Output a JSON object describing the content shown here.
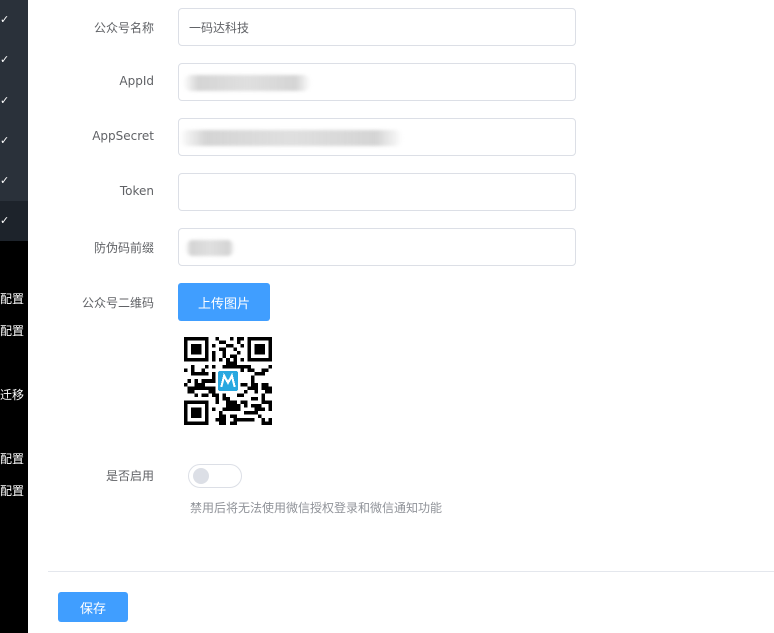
{
  "sidebar": {
    "items": [
      {
        "label": "配置"
      },
      {
        "label": "配置"
      },
      {
        "label": "迁移"
      },
      {
        "label": "配置"
      },
      {
        "label": "配置"
      }
    ]
  },
  "form": {
    "name": {
      "label": "公众号名称",
      "value": "一码达科技"
    },
    "appid": {
      "label": "AppId"
    },
    "appsecret": {
      "label": "AppSecret"
    },
    "token": {
      "label": "Token"
    },
    "prefix": {
      "label": "防伪码前缀"
    },
    "qrcode": {
      "label": "公众号二维码",
      "upload_label": "上传图片"
    },
    "enabled": {
      "label": "是否启用",
      "state": "off",
      "hint": "禁用后将无法使用微信授权登录和微信通知功能"
    }
  },
  "footer": {
    "save_label": "保存"
  },
  "colors": {
    "primary": "#409eff",
    "sidebar_top": "#2a313a",
    "sidebar_bottom": "#000000"
  }
}
